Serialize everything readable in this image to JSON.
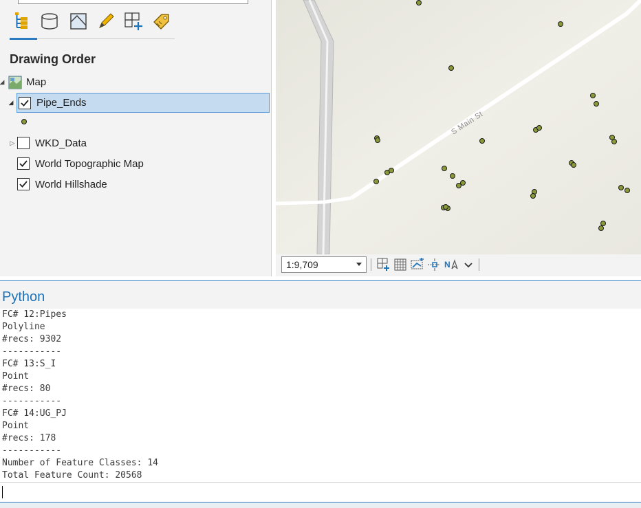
{
  "contents": {
    "title": "Drawing Order",
    "layers": [
      {
        "label": "Map",
        "checked": null
      },
      {
        "label": "Pipe_Ends",
        "checked": true
      },
      {
        "label": "WKD_Data",
        "checked": false
      },
      {
        "label": "World Topographic Map",
        "checked": true
      },
      {
        "label": "World Hillshade",
        "checked": true
      }
    ],
    "tools": [
      "drawing-order-icon",
      "data-source-icon",
      "selection-icon",
      "editing-icon",
      "snapping-icon",
      "labeling-icon"
    ]
  },
  "map": {
    "street_label": "S Main St",
    "scale": "1:9,709",
    "point_color": "#8a9a3a"
  },
  "python": {
    "title": "Python",
    "output": [
      "FC# 12:Pipes",
      "Polyline",
      "#recs: 9302",
      "-----------",
      "FC# 13:S_I",
      "Point",
      "#recs: 80",
      "-----------",
      "FC# 14:UG_PJ",
      "Point",
      "#recs: 178",
      "-----------",
      "Number of Feature Classes: 14",
      "Total Feature Count: 20568"
    ]
  },
  "colors": {
    "accent": "#2b7bc0",
    "selection": "#c5dcf0"
  }
}
